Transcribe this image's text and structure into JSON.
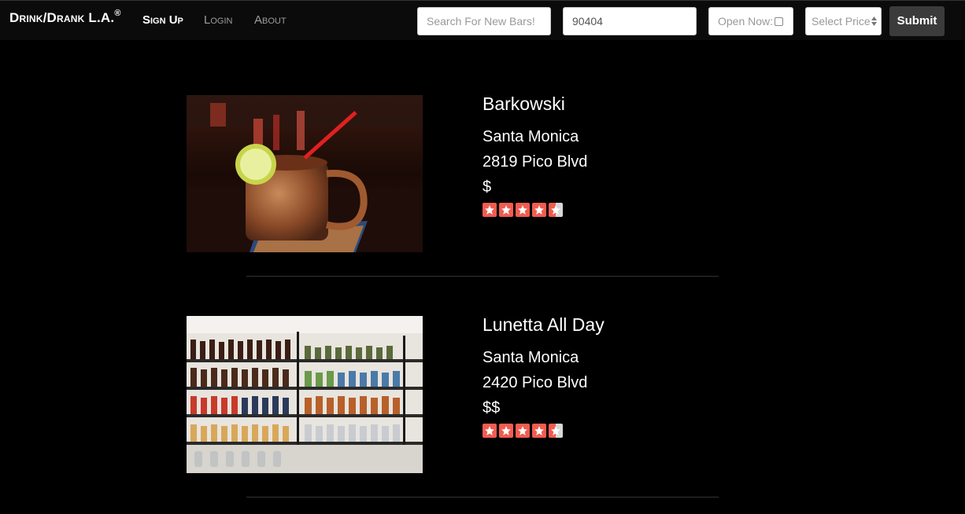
{
  "nav": {
    "brand": "Drink/Drank L.A.",
    "brand_mark": "®",
    "links": [
      {
        "label": "Sign Up",
        "active": true
      },
      {
        "label": "Login",
        "active": false
      },
      {
        "label": "About",
        "active": false
      }
    ]
  },
  "search": {
    "bars_placeholder": "Search For New Bars!",
    "zip_value": "90404",
    "open_now_label": "Open Now:",
    "price_select": "Select Price",
    "submit_label": "Submit"
  },
  "results": [
    {
      "name": "Barkowski",
      "city": "Santa Monica",
      "address": "2819 Pico Blvd",
      "price": "$",
      "rating": 4.5
    },
    {
      "name": "Lunetta All Day",
      "city": "Santa Monica",
      "address": "2420 Pico Blvd",
      "price": "$$",
      "rating": 4.5
    }
  ],
  "colors": {
    "background": "#000000",
    "navbar": "#0b0b0b",
    "star": "#f15c4f",
    "submit_button": "#3b3b3b"
  }
}
